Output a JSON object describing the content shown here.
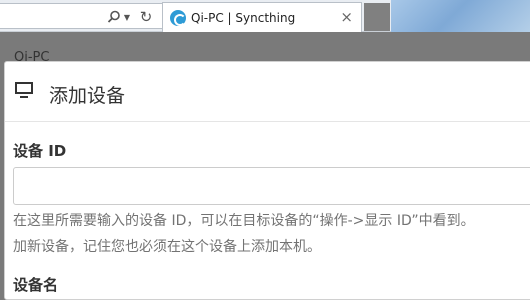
{
  "browser": {
    "tab_title": "Qi-PC | Syncthing",
    "tab_close": "×",
    "search_glyph": "⚲",
    "dropdown_glyph": "▼",
    "refresh_glyph": "↻"
  },
  "background_page": {
    "partial_text": "Qi-PC"
  },
  "modal": {
    "title": "添加设备",
    "icon": "monitor-icon",
    "device_id": {
      "label": "设备 ID",
      "value": "",
      "help_line1": "在这里所需要输入的设备 ID，可以在目标设备的“操作->显示 ID”中看到。",
      "help_line2": "加新设备，记住您也必须在这个设备上添加本机。"
    },
    "device_name": {
      "label": "设备名"
    }
  },
  "colors": {
    "backdrop": "#7a7a7a",
    "favicon": "#2e9bd6",
    "help_text": "#737373"
  }
}
